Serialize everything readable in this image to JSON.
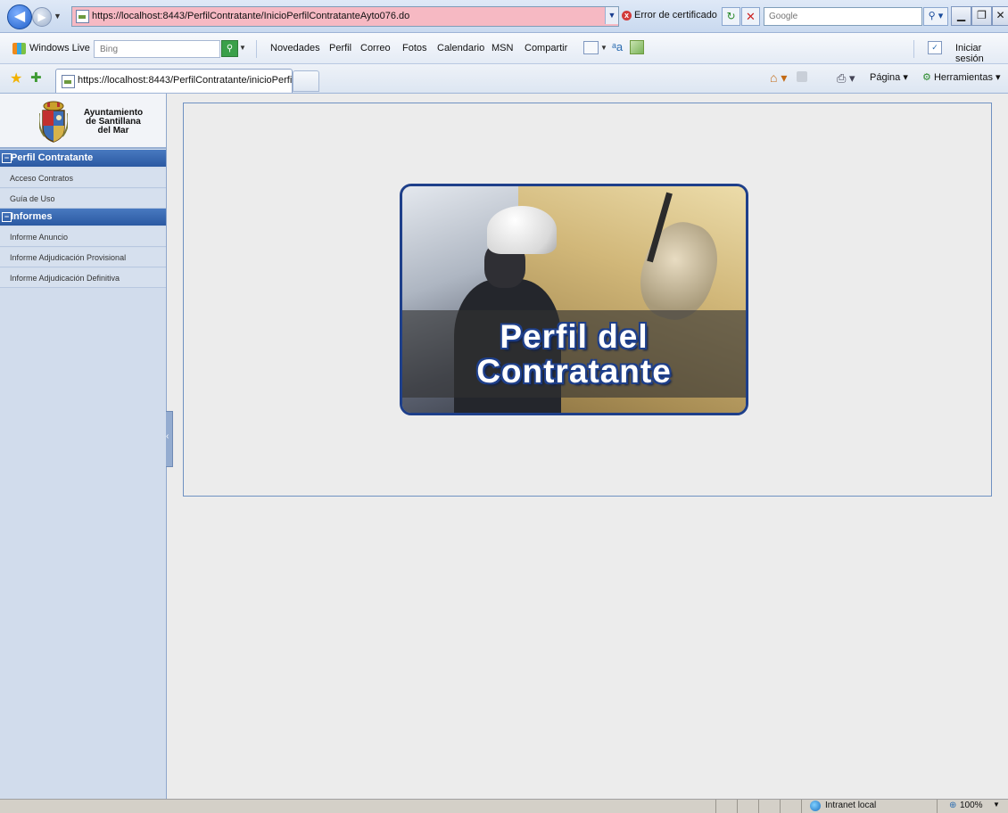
{
  "browser": {
    "url": "https://localhost:8443/PerfilContratante/InicioPerfilContratanteAyto076.do",
    "cert_error": "Error de certificado",
    "search_placeholder": "Google",
    "tab_title": "https://localhost:8443/PerfilContratante/inicioPerfilCo...",
    "cmd_page": "Página",
    "cmd_tools": "Herramientas"
  },
  "live_toolbar": {
    "brand": "Windows Live",
    "search_placeholder": "Bing",
    "links": [
      "Novedades",
      "Perfil",
      "Correo",
      "Fotos",
      "Calendario",
      "MSN",
      "Compartir"
    ],
    "signin": "Iniciar sesión"
  },
  "sidebar": {
    "org_name": "Ayuntamiento\nde Santillana\ndel Mar",
    "sections": [
      {
        "label": "Perfil Contratante",
        "items": [
          "Acceso Contratos",
          "Guía de Uso"
        ]
      },
      {
        "label": "Informes",
        "items": [
          "Informe Anuncio",
          "Informe Adjudicación Provisional",
          "Informe Adjudicación Definitiva"
        ]
      }
    ]
  },
  "main": {
    "banner_title": "Perfil del\nContratante"
  },
  "statusbar": {
    "zone": "Intranet local",
    "zoom": "100%"
  },
  "colors": {
    "sidebar_header": "#2b59a2",
    "banner_border": "#1e3f8a",
    "address_error": "#f6b9c3"
  }
}
